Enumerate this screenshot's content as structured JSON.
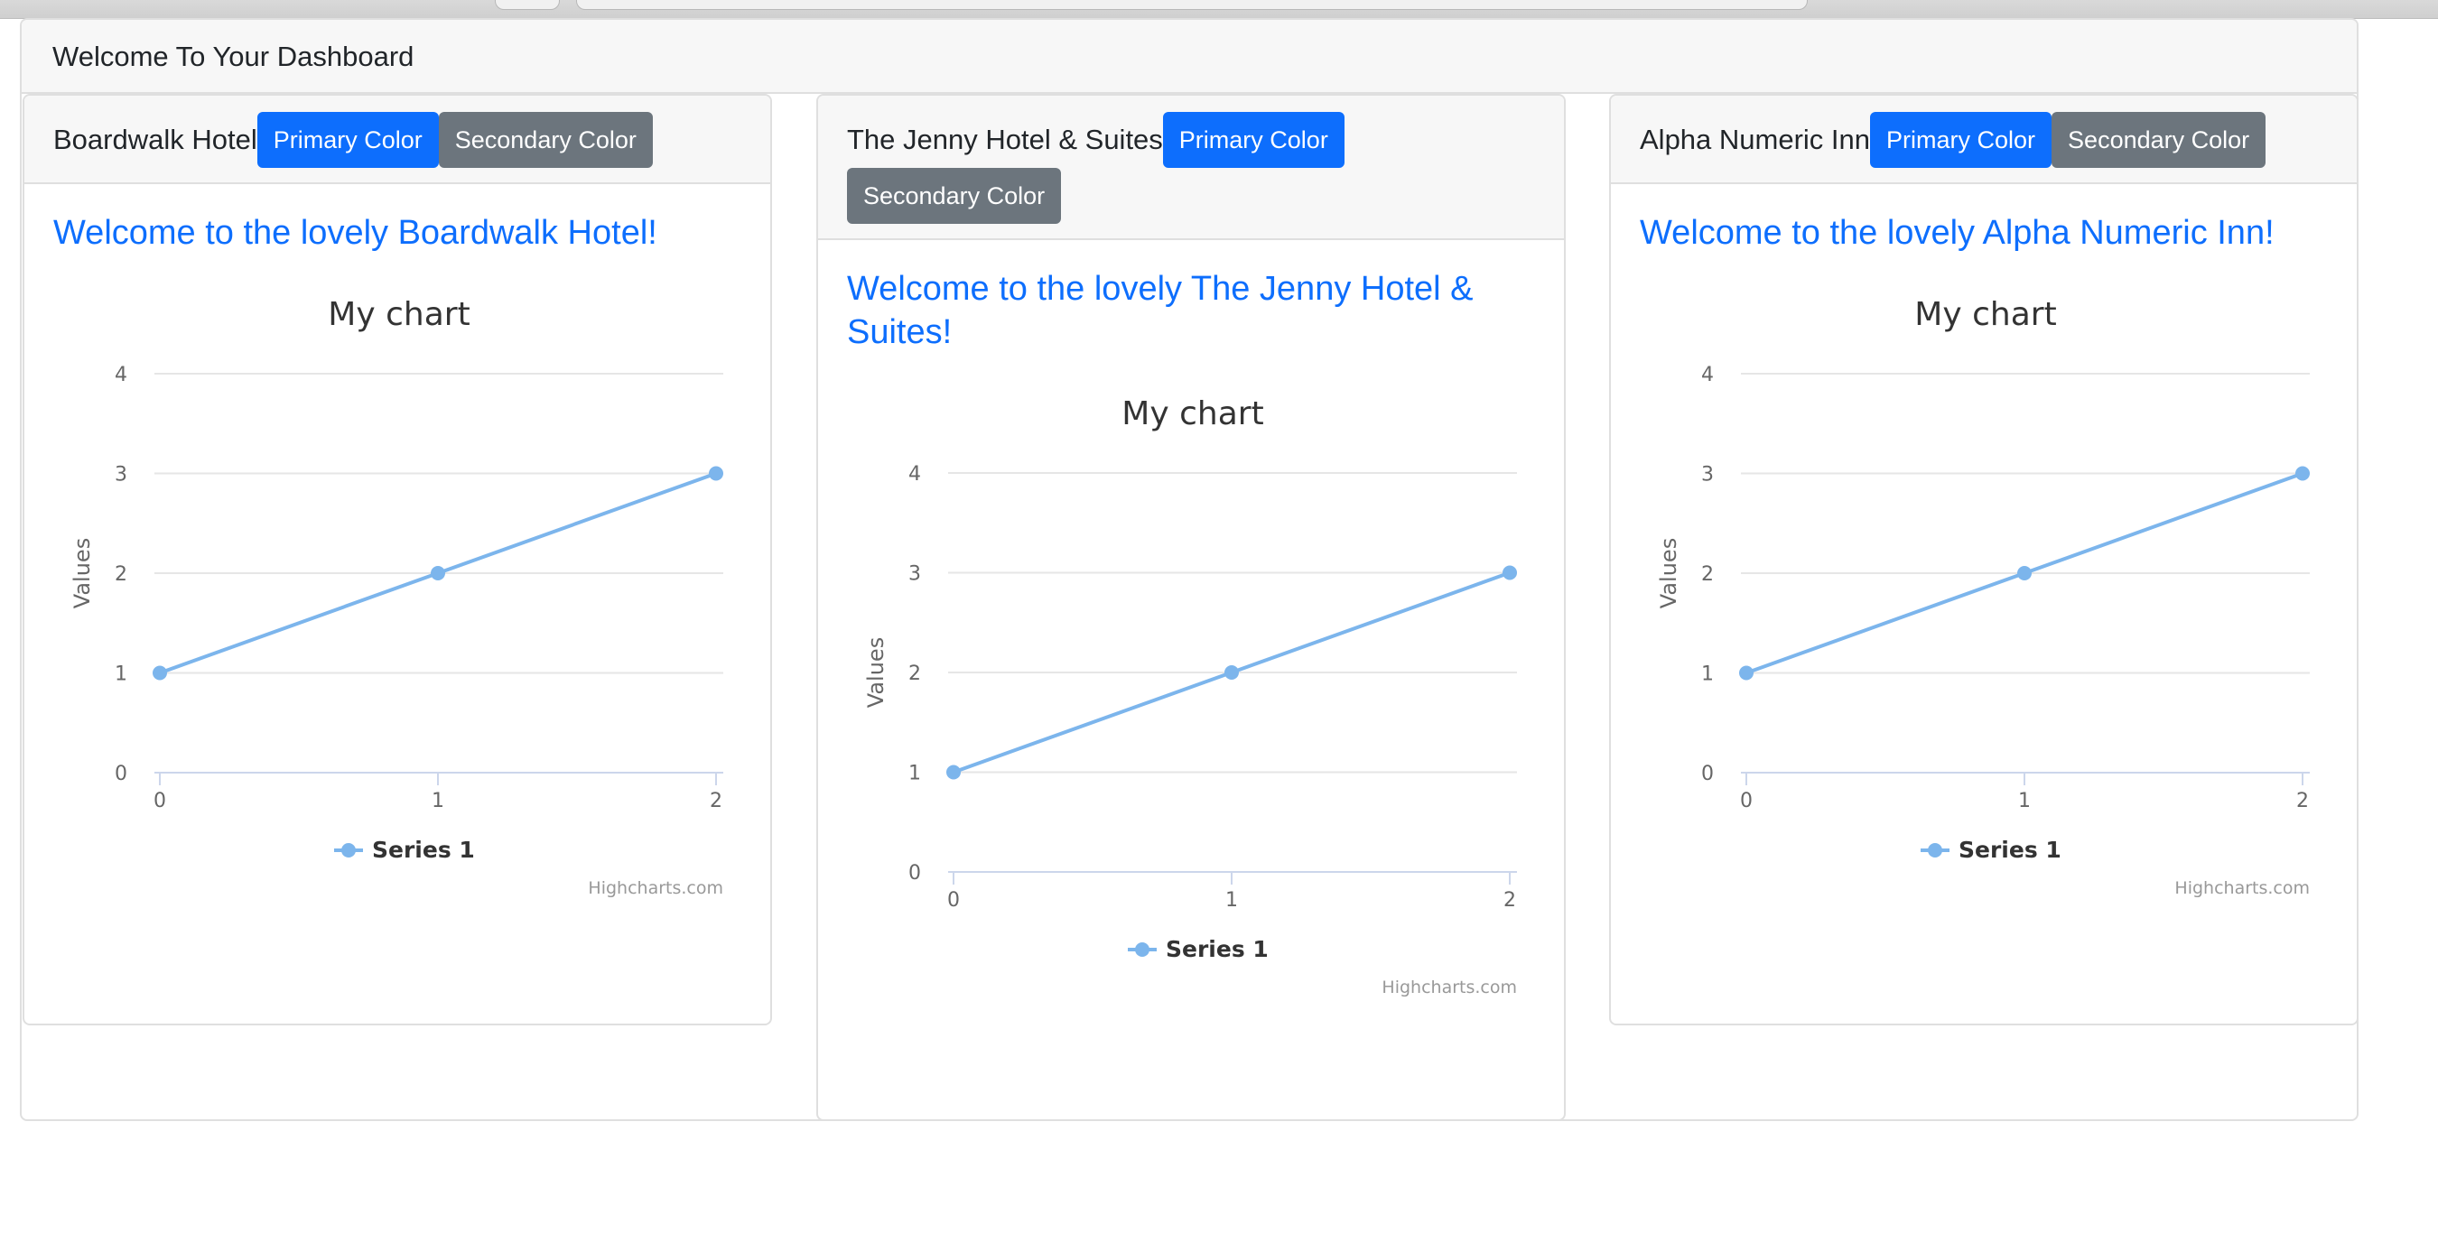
{
  "dashboard": {
    "title": "Welcome To Your Dashboard"
  },
  "buttons": {
    "primary_label": "Primary Color",
    "secondary_label": "Secondary Color"
  },
  "colors": {
    "primary": "#0d6efd",
    "secondary": "#6c757d",
    "series": "#7cb5ec"
  },
  "hotels": [
    {
      "name": "Boardwalk Hotel",
      "welcome": "Welcome to the lovely Boardwalk Hotel!",
      "chart_title": "My chart",
      "ylabel": "Values",
      "legend": "Series 1",
      "credits": "Highcharts.com"
    },
    {
      "name": "The Jenny Hotel & Suites",
      "welcome": "Welcome to the lovely The Jenny Hotel & Suites!",
      "chart_title": "My chart",
      "ylabel": "Values",
      "legend": "Series 1",
      "credits": "Highcharts.com"
    },
    {
      "name": "Alpha Numeric Inn",
      "welcome": "Welcome to the lovely Alpha Numeric Inn!",
      "chart_title": "My chart",
      "ylabel": "Values",
      "legend": "Series 1",
      "credits": "Highcharts.com"
    }
  ],
  "chart_data": [
    {
      "type": "line",
      "title": "My chart",
      "ylabel": "Values",
      "x": [
        0,
        1,
        2
      ],
      "series": [
        {
          "name": "Series 1",
          "values": [
            1,
            2,
            3
          ]
        }
      ],
      "xticks": [
        0,
        1,
        2
      ],
      "yticks": [
        0,
        1,
        2,
        3,
        4
      ],
      "ylim": [
        0,
        4
      ],
      "xlim": [
        0,
        2
      ],
      "grid": true,
      "legend": "bottom-center"
    },
    {
      "type": "line",
      "title": "My chart",
      "ylabel": "Values",
      "x": [
        0,
        1,
        2
      ],
      "series": [
        {
          "name": "Series 1",
          "values": [
            1,
            2,
            3
          ]
        }
      ],
      "xticks": [
        0,
        1,
        2
      ],
      "yticks": [
        0,
        1,
        2,
        3,
        4
      ],
      "ylim": [
        0,
        4
      ],
      "xlim": [
        0,
        2
      ],
      "grid": true,
      "legend": "bottom-center"
    },
    {
      "type": "line",
      "title": "My chart",
      "ylabel": "Values",
      "x": [
        0,
        1,
        2
      ],
      "series": [
        {
          "name": "Series 1",
          "values": [
            1,
            2,
            3
          ]
        }
      ],
      "xticks": [
        0,
        1,
        2
      ],
      "yticks": [
        0,
        1,
        2,
        3,
        4
      ],
      "ylim": [
        0,
        4
      ],
      "xlim": [
        0,
        2
      ],
      "grid": true,
      "legend": "bottom-center"
    }
  ]
}
